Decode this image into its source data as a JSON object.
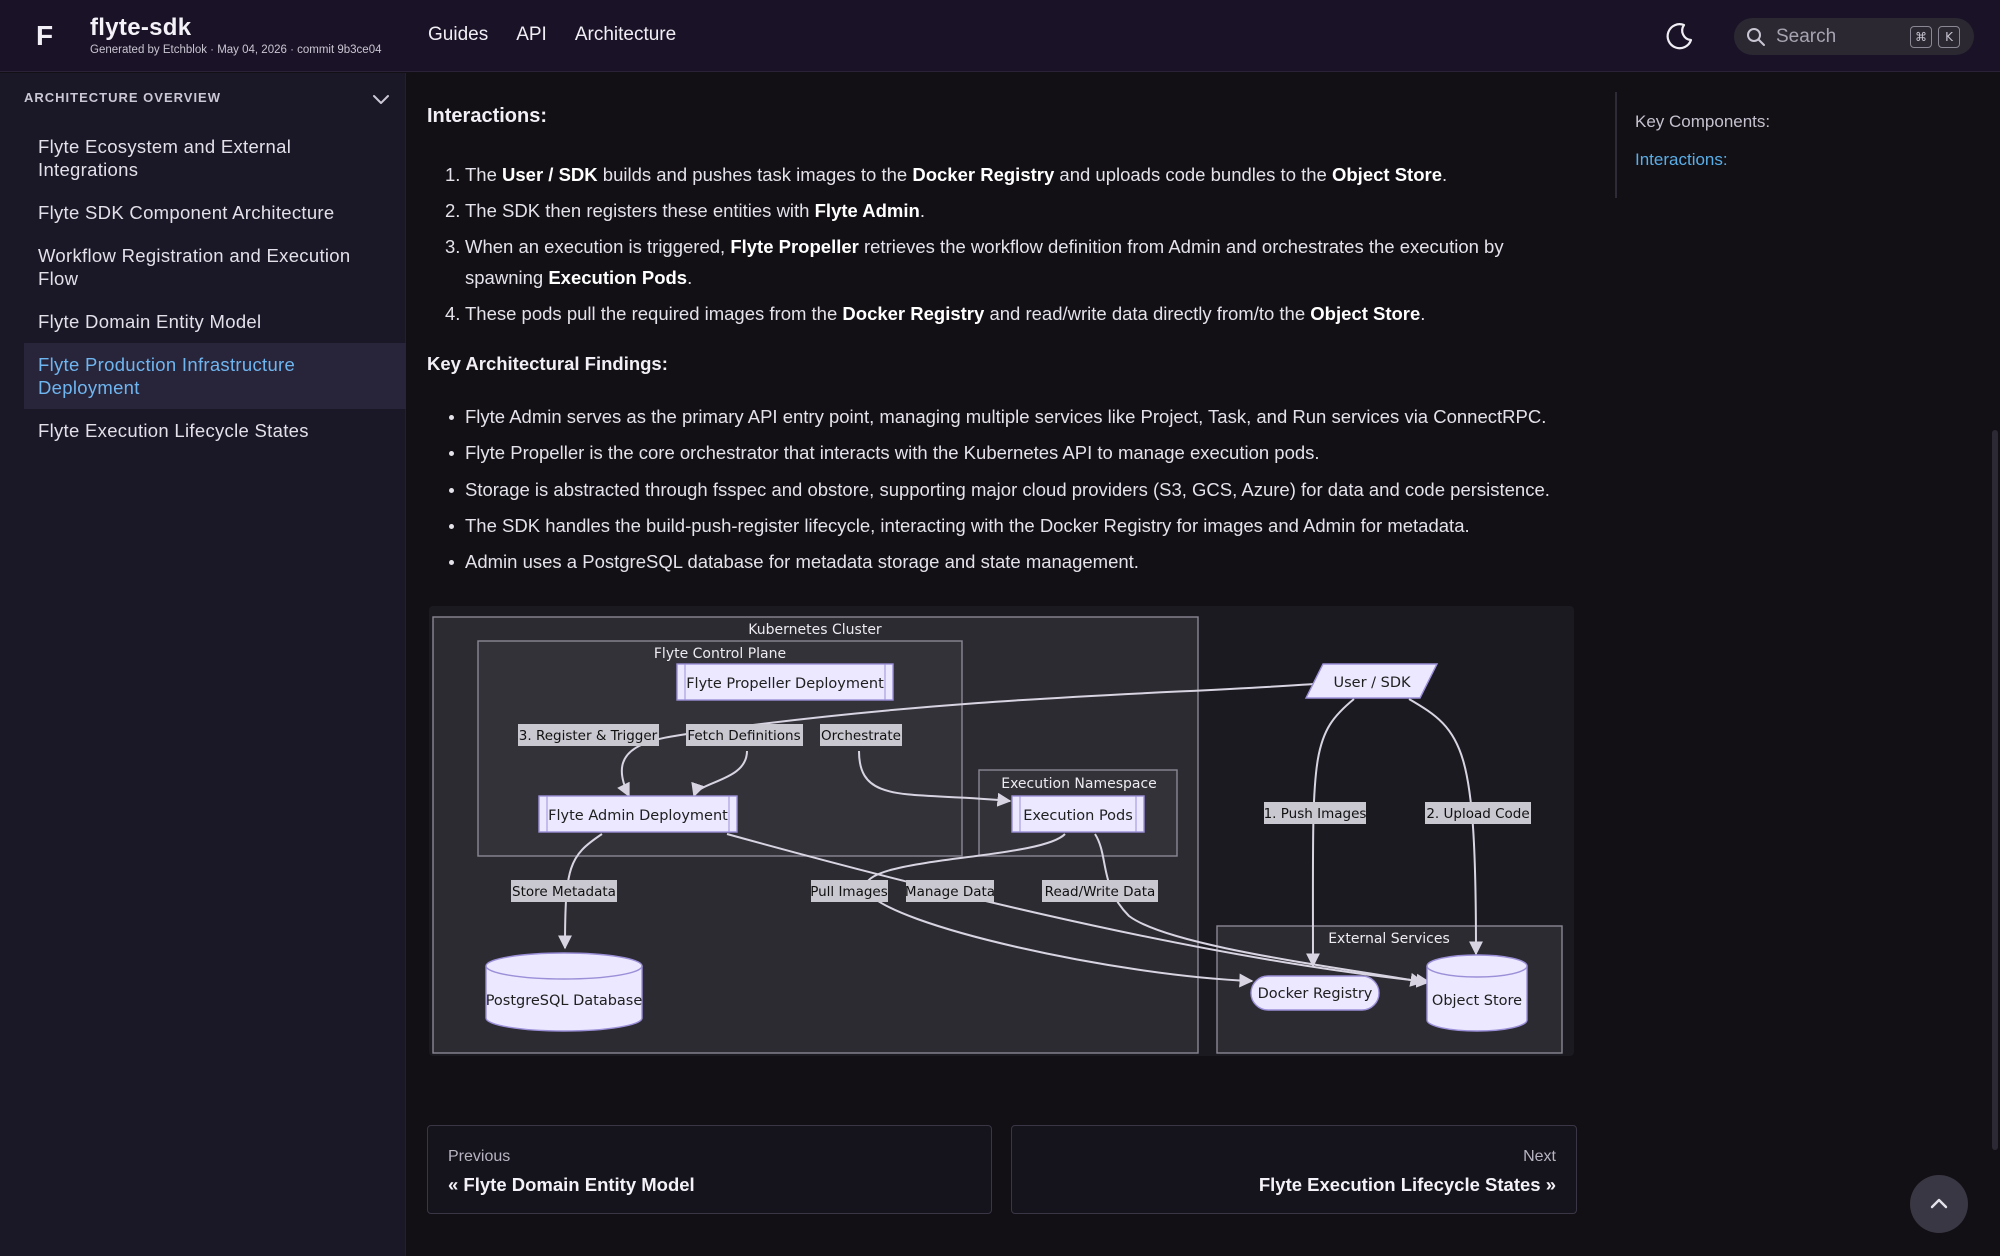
{
  "header": {
    "logo": "F",
    "title": "flyte-sdk",
    "meta": "Generated by Etchblok · May 04, 2026 · commit 9b3ce04",
    "nav": [
      "Guides",
      "API",
      "Architecture"
    ],
    "search_placeholder": "Search",
    "kbd": [
      "⌘",
      "K"
    ]
  },
  "sidebar": {
    "heading": "ARCHITECTURE OVERVIEW",
    "items": [
      {
        "label": "Flyte Ecosystem and External Integrations",
        "active": false
      },
      {
        "label": "Flyte SDK Component Architecture",
        "active": false
      },
      {
        "label": "Workflow Registration and Execution Flow",
        "active": false
      },
      {
        "label": "Flyte Domain Entity Model",
        "active": false
      },
      {
        "label": "Flyte Production Infrastructure Deployment",
        "active": true
      },
      {
        "label": "Flyte Execution Lifecycle States",
        "active": false
      }
    ]
  },
  "content": {
    "interactions_heading": "Interactions:",
    "steps": [
      {
        "n": "1.",
        "html": "The <b>User / SDK</b> builds and pushes task images to the <b>Docker Registry</b> and uploads code bundles to the <b>Object Store</b>."
      },
      {
        "n": "2.",
        "html": "The SDK then registers these entities with <b>Flyte Admin</b>."
      },
      {
        "n": "3.",
        "html": "When an execution is triggered, <b>Flyte Propeller</b> retrieves the workflow definition from Admin and orchestrates the execution by spawning <b>Execution Pods</b>."
      },
      {
        "n": "4.",
        "html": "These pods pull the required images from the <b>Docker Registry</b> and read/write data directly from/to the <b>Object Store</b>."
      }
    ],
    "findings_heading": "Key Architectural Findings:",
    "findings": [
      "Flyte Admin serves as the primary API entry point, managing multiple services like Project, Task, and Run services via ConnectRPC.",
      "Flyte Propeller is the core orchestrator that interacts with the Kubernetes API to manage execution pods.",
      "Storage is abstracted through fsspec and obstore, supporting major cloud providers (S3, GCS, Azure) for data and code persistence.",
      "The SDK handles the build-push-register lifecycle, interacting with the Docker Registry for images and Admin for metadata.",
      "Admin uses a PostgreSQL database for metadata storage and state management."
    ]
  },
  "diagram": {
    "clusters": {
      "k8s": "Kubernetes Cluster",
      "control": "Flyte Control Plane",
      "exec_ns": "Execution Namespace",
      "external": "External Services"
    },
    "nodes": {
      "propeller": "Flyte Propeller Deployment",
      "admin": "Flyte Admin Deployment",
      "pods": "Execution Pods",
      "postgres": "PostgreSQL Database",
      "user": "User / SDK",
      "docker": "Docker Registry",
      "store": "Object Store"
    },
    "edges": {
      "register": "3. Register & Trigger",
      "fetch": "Fetch Definitions",
      "orchestrate": "Orchestrate",
      "store_meta": "Store Metadata",
      "pull": "Pull Images",
      "manage": "Manage Data",
      "rw": "Read/Write Data",
      "push": "1. Push Images",
      "upload": "2. Upload Code"
    }
  },
  "pager": {
    "prev_label": "Previous",
    "prev_title": "« Flyte Domain Entity Model",
    "next_label": "Next",
    "next_title": "Flyte Execution Lifecycle States »"
  },
  "toc": {
    "items": [
      {
        "label": "Key Components:",
        "active": false
      },
      {
        "label": "Interactions:",
        "active": true
      }
    ]
  },
  "colors": {
    "accent": "#6fb6f0",
    "header_bg": "#1a1226",
    "sidebar_bg": "#1a1726",
    "node_fill": "#ece8ff",
    "node_stroke": "#9b8fd8"
  }
}
